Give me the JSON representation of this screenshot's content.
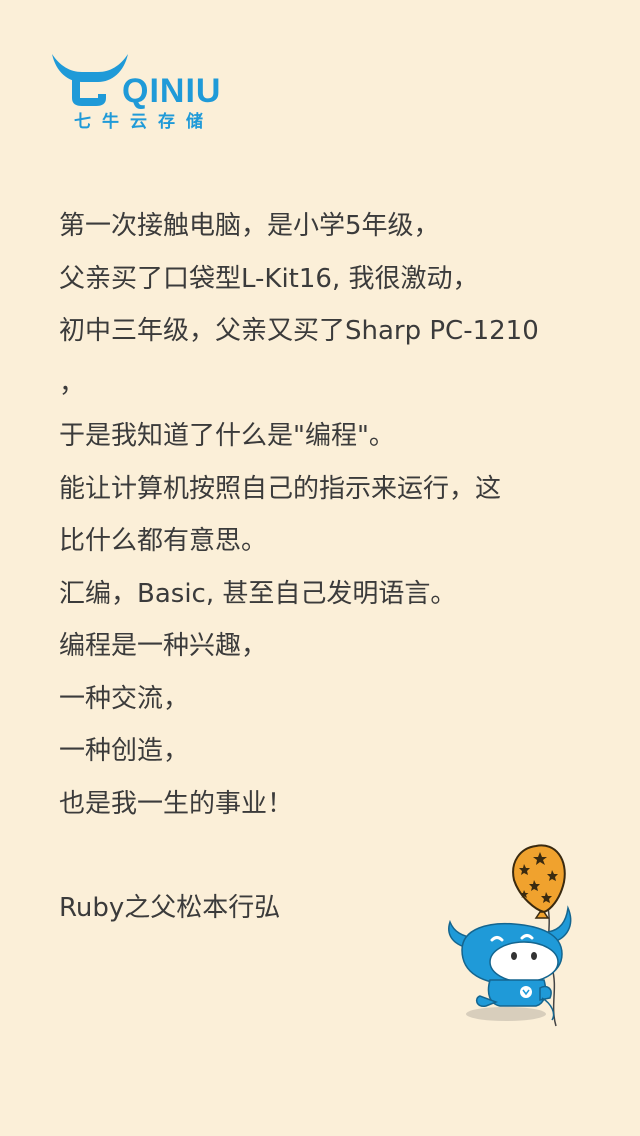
{
  "brand": {
    "name": "QINIU",
    "subtitle": "七牛云存储",
    "color": "#1f9ad8"
  },
  "poem": {
    "lines": [
      "第一次接触电脑，是小学5年级，",
      "父亲买了口袋型L-Kit16, 我很激动，",
      "初中三年级，父亲又买了Sharp PC-1210",
      "，",
      "于是我知道了什么是\"编程\"。",
      "能让计算机按照自己的指示来运行，这",
      "比什么都有意思。",
      "汇编，Basic, 甚至自己发明语言。",
      "编程是一种兴趣，",
      "一种交流，",
      "一种创造，",
      "也是我一生的事业！"
    ],
    "author": "Ruby之父松本行弘"
  },
  "colors": {
    "background": "#fbefd8",
    "text": "#3b3b3b",
    "balloon": "#f0a22e"
  },
  "icons": {
    "logo": "qiniu-bull-logo-icon",
    "mascot": "bull-mascot-with-balloon-icon"
  }
}
